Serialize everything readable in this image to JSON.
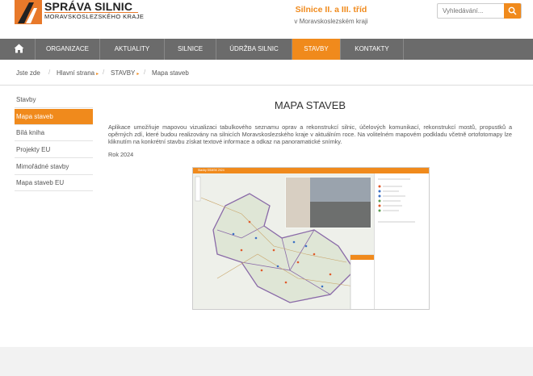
{
  "header": {
    "logo_title": "SPRÁVA SILNIC",
    "logo_subtitle": "MORAVSKOSLEZSKÉHO KRAJE",
    "tagline_title": "Silnice II. a III. tříd",
    "tagline_subtitle": "v Moravskoslezském kraji",
    "search_placeholder": "Vyhledávání...",
    "accent": "#f08a1c"
  },
  "nav": {
    "items": [
      {
        "label": "ORGANIZACE"
      },
      {
        "label": "AKTUALITY"
      },
      {
        "label": "SILNICE"
      },
      {
        "label": "ÚDRŽBA SILNIC"
      },
      {
        "label": "STAVBY"
      },
      {
        "label": "KONTAKTY"
      }
    ],
    "active": "STAVBY"
  },
  "breadcrumb": {
    "prefix": "Jste zde",
    "items": [
      "Hlavní strana",
      "STAVBY",
      "Mapa staveb"
    ]
  },
  "sidebar": {
    "items": [
      {
        "label": "Stavby"
      },
      {
        "label": "Mapa staveb"
      },
      {
        "label": "Bílá kniha"
      },
      {
        "label": "Projekty EU"
      },
      {
        "label": "Mimořádné stavby"
      },
      {
        "label": "Mapa staveb EU"
      }
    ],
    "active": "Mapa staveb"
  },
  "main": {
    "title": "MAPA STAVEB",
    "description": "Aplikace umožňuje mapovou vizualizaci tabulkového seznamu oprav a rekonstrukcí silnic, účelových komunikací, rekonstrukcí mostů, propustků a opěrných zdí, které budou realizovány na silnicích Moravskoslezského kraje v aktuálním roce. Na volitelném mapovém podkladu včetně ortofotomapy lze kliknutím na konkrétní stavbu získat textové informace a odkaz na panoramatické snímky.",
    "year": "Rok 2024"
  },
  "map": {
    "title": "Stavby SSMSK 2024"
  }
}
